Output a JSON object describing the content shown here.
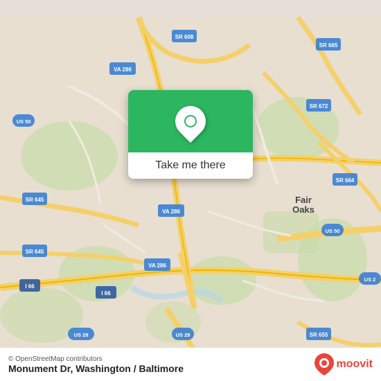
{
  "map": {
    "alt": "Map of Monument Dr, Washington / Baltimore area",
    "attribution": "© OpenStreetMap contributors",
    "location_label": "Monument Dr, Washington / Baltimore"
  },
  "card": {
    "button_label": "Take me there"
  },
  "branding": {
    "moovit_label": "moovit"
  },
  "road_labels": {
    "sr608": "SR 608",
    "va286_top": "VA 286",
    "sr665": "SR 665",
    "sr672": "SR 672",
    "us50_left": "US 50",
    "va286_mid": "VA 286",
    "sr664": "SR 664",
    "sr645_left": "SR 645",
    "sr645_btm": "SR 645",
    "i66_left": "I 66",
    "i66_btm": "I 66",
    "va286_btm": "VA 286",
    "us29": "US 29",
    "fair_oaks": "Fair\nOaks",
    "us50_right": "US 50",
    "us25_right": "US 2",
    "sr655": "SR 655"
  }
}
